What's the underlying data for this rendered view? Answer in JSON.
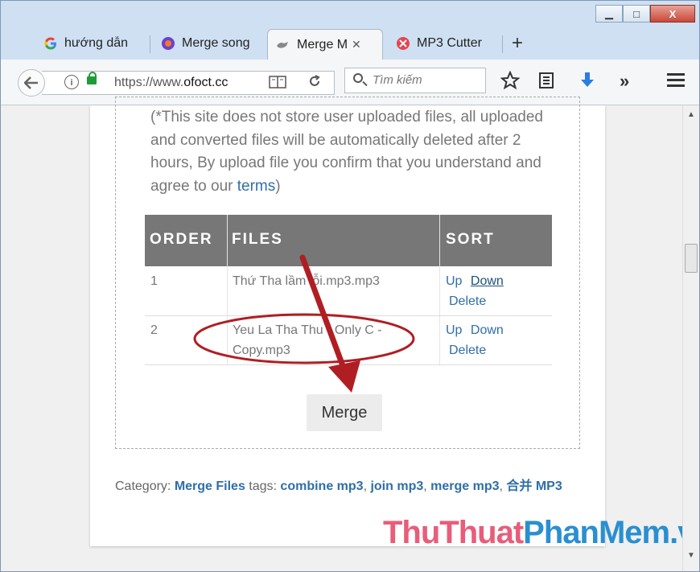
{
  "window": {
    "minimize_label": "▁",
    "maximize_label": "□",
    "close_label": "X"
  },
  "tabs": [
    {
      "label": "hướng dẫn",
      "icon": "google-icon"
    },
    {
      "label": "Merge song",
      "icon": "firefox-icon"
    },
    {
      "label": "Merge M",
      "icon": "ofoct-icon",
      "active": true
    },
    {
      "label": "MP3 Cutter",
      "icon": "scissors-icon"
    }
  ],
  "newtab_label": "+",
  "tab_close": "✕",
  "urlbar": {
    "prefix": "https://www.",
    "domain": "ofoct.cc"
  },
  "search": {
    "placeholder": "Tìm kiếm"
  },
  "toolbar": {
    "overflow": "»",
    "menu": "☰"
  },
  "notice": {
    "text_before": "(*This site does not store user uploaded files, all uploaded and converted files will be automatically deleted after 2 hours, By upload file you confirm that you understand and agree to our ",
    "link": "terms",
    "text_after": ")"
  },
  "table": {
    "headers": [
      "ORDER",
      "FILES",
      "SORT"
    ],
    "rows": [
      {
        "order": "1",
        "file": "Thứ Tha lầm lỗi.mp3.mp3",
        "up": "Up",
        "down": "Down",
        "delete": "Delete"
      },
      {
        "order": "2",
        "file": "Yeu La Tha Thu - Only C - Copy.mp3",
        "up": "Up",
        "down": "Down",
        "delete": "Delete"
      }
    ]
  },
  "merge_button": "Merge",
  "category": {
    "label": "Category: ",
    "category_link": "Merge Files",
    "tags_label": " tags: ",
    "tags": [
      "combine mp3",
      "join mp3",
      "merge mp3",
      "合并 MP3"
    ]
  },
  "watermark": {
    "part1": "ThuThuat",
    "part2": "PhanMem",
    "part3": ".vn"
  },
  "colors": {
    "link": "#2f6fa7",
    "table_header": "#777777",
    "annotation_red": "#b01e23",
    "watermark_pink": "#e85d7a",
    "watermark_blue": "#2a8fd0"
  }
}
